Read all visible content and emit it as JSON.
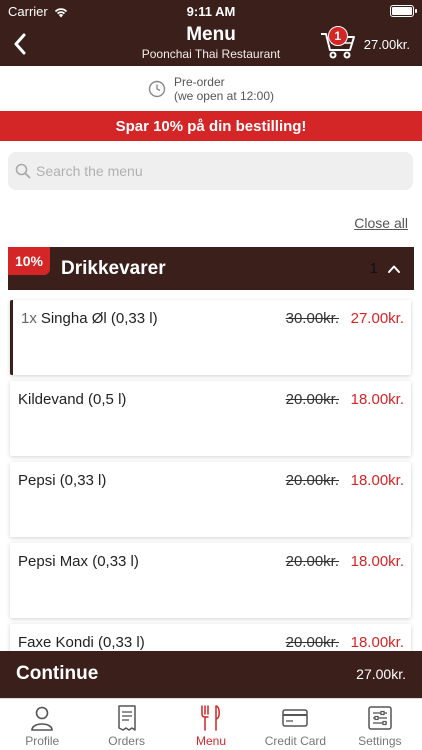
{
  "status_bar": {
    "carrier": "Carrier",
    "time": "9:11 AM"
  },
  "header": {
    "title": "Menu",
    "subtitle": "Poonchai Thai Restaurant",
    "cart_count": "1",
    "cart_total": "27.00kr."
  },
  "preorder": {
    "line1": "Pre-order",
    "line2": "(we open at 12:00)"
  },
  "promo_banner": "Spar 10% på din bestilling!",
  "search": {
    "placeholder": "Search the menu",
    "value": ""
  },
  "close_all": "Close all",
  "category": {
    "discount": "10%",
    "name": "Drikkevarer",
    "count": "1"
  },
  "items": [
    {
      "qty": "1x",
      "name": "Singha Øl (0,33 l)",
      "old_price": "30.00kr.",
      "new_price": "27.00kr."
    },
    {
      "qty": "",
      "name": "Kildevand (0,5 l)",
      "old_price": "20.00kr.",
      "new_price": "18.00kr."
    },
    {
      "qty": "",
      "name": "Pepsi (0,33 l)",
      "old_price": "20.00kr.",
      "new_price": "18.00kr."
    },
    {
      "qty": "",
      "name": "Pepsi Max (0,33 l)",
      "old_price": "20.00kr.",
      "new_price": "18.00kr."
    },
    {
      "qty": "",
      "name": "Faxe Kondi (0,33 l)",
      "old_price": "20.00kr.",
      "new_price": "18.00kr."
    }
  ],
  "continue_bar": {
    "label": "Continue",
    "total": "27.00kr."
  },
  "tabs": [
    {
      "label": "Profile",
      "icon": "person-icon"
    },
    {
      "label": "Orders",
      "icon": "receipt-icon"
    },
    {
      "label": "Menu",
      "icon": "fork-knife-icon",
      "active": true
    },
    {
      "label": "Credit Card",
      "icon": "credit-card-icon"
    },
    {
      "label": "Settings",
      "icon": "sliders-icon"
    }
  ],
  "colors": {
    "brand_dark": "#3a1f1a",
    "accent_red": "#d42527"
  }
}
